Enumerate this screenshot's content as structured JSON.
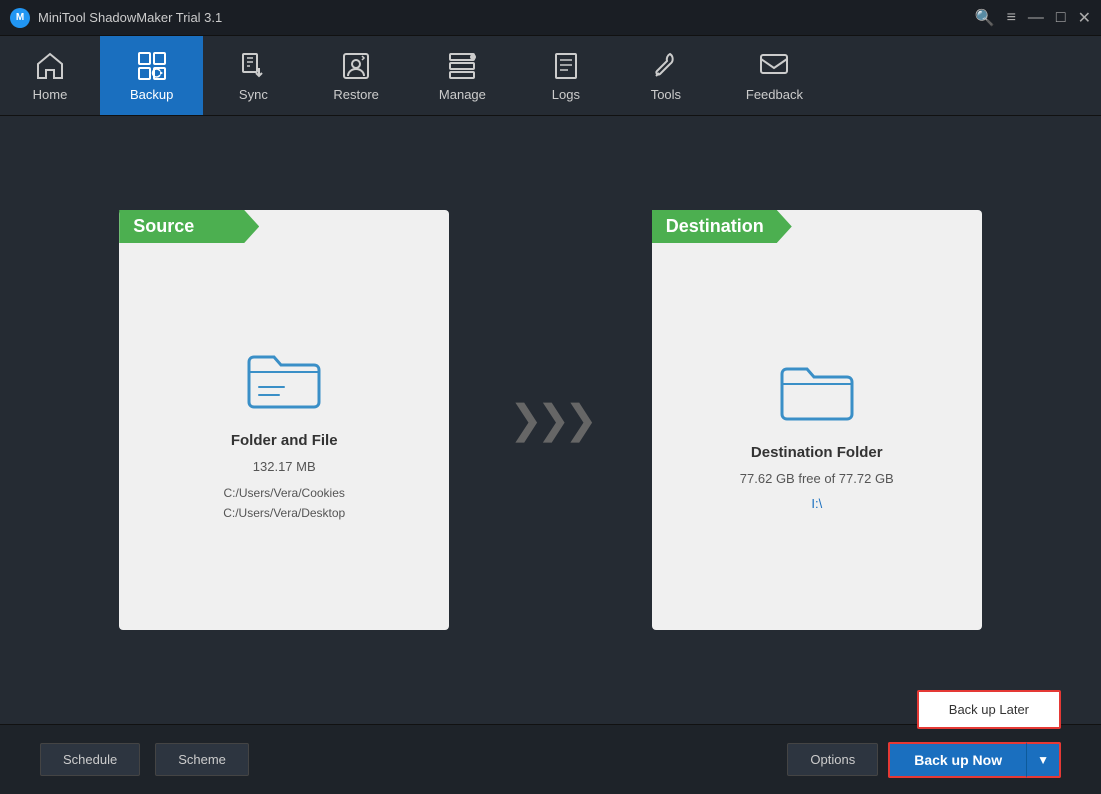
{
  "app": {
    "title": "MiniTool ShadowMaker Trial 3.1"
  },
  "titlebar": {
    "search_icon": "🔍",
    "menu_icon": "≡",
    "minimize_icon": "—",
    "maximize_icon": "□",
    "close_icon": "✕"
  },
  "navbar": {
    "items": [
      {
        "id": "home",
        "label": "Home",
        "active": false
      },
      {
        "id": "backup",
        "label": "Backup",
        "active": true
      },
      {
        "id": "sync",
        "label": "Sync",
        "active": false
      },
      {
        "id": "restore",
        "label": "Restore",
        "active": false
      },
      {
        "id": "manage",
        "label": "Manage",
        "active": false
      },
      {
        "id": "logs",
        "label": "Logs",
        "active": false
      },
      {
        "id": "tools",
        "label": "Tools",
        "active": false
      },
      {
        "id": "feedback",
        "label": "Feedback",
        "active": false
      }
    ]
  },
  "source": {
    "header": "Source",
    "title": "Folder and File",
    "size": "132.17 MB",
    "path1": "C:/Users/Vera/Cookies",
    "path2": "C:/Users/Vera/Desktop"
  },
  "destination": {
    "header": "Destination",
    "title": "Destination Folder",
    "size": "77.62 GB free of 77.72 GB",
    "path": "I:\\"
  },
  "bottom": {
    "schedule_label": "Schedule",
    "scheme_label": "Scheme",
    "options_label": "Options",
    "backup_now_label": "Back up Now",
    "backup_later_label": "Back up Later"
  }
}
